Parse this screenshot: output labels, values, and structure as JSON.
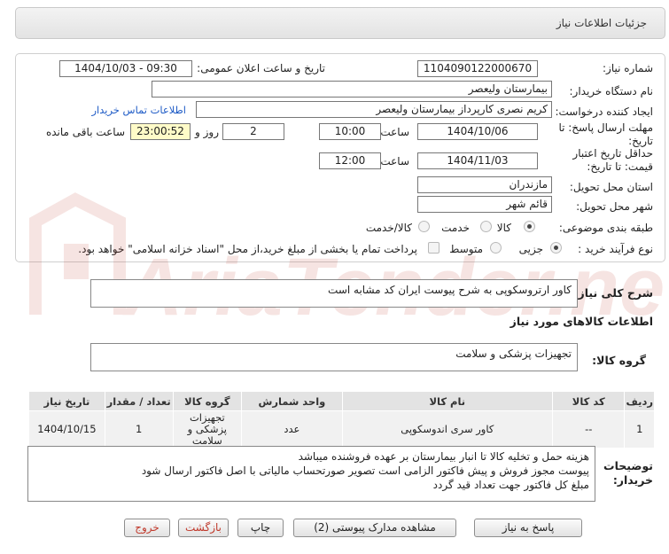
{
  "header": {
    "title": "جزئیات اطلاعات نیاز"
  },
  "form": {
    "need_number_label": "شماره نیاز:",
    "need_number": "1104090122000670",
    "announce_label": "تاریخ و ساعت اعلان عمومی:",
    "announce_value": "1404/10/03 - 09:30",
    "buyer_org_label": "نام دستگاه خریدار:",
    "buyer_org": "بیمارستان ولیعصر",
    "creator_label": "ایجاد کننده درخواست:",
    "creator": "کریم نصری کارپرداز بیمارستان ولیعصر",
    "contact_link": "اطلاعات تماس خریدار",
    "deadline_label": "مهلت ارسال پاسخ: تا تاریخ:",
    "deadline_date": "1404/10/06",
    "time_label": "ساعت",
    "deadline_time": "10:00",
    "days_value": "2",
    "days_label": "روز و",
    "remaining_time": "23:00:52",
    "remaining_label": "ساعت باقی مانده",
    "validity_label": "حداقل تاریخ اعتبار قیمت: تا تاریخ:",
    "validity_date": "1404/11/03",
    "validity_time": "12:00",
    "province_label": "استان محل تحویل:",
    "province": "مازندران",
    "city_label": "شهر محل تحویل:",
    "city": "قائم شهر",
    "category_label": "طبقه بندی موضوعی:",
    "category_options": [
      "کالا",
      "خدمت",
      "کالا/خدمت"
    ],
    "category_selected": "کالا",
    "process_label": "نوع فرآیند خرید :",
    "process_options": [
      "جزیی",
      "متوسط"
    ],
    "process_selected": "جزیی",
    "payment_note": "پرداخت تمام یا بخشی از مبلغ خرید،از محل \"اسناد خزانه اسلامی\" خواهد بود."
  },
  "summary": {
    "label": "شرح کلی نیاز:",
    "value": "کاور ارتروسکوپی به شرح پیوست    ایران کد مشابه است"
  },
  "goods_info_title": "اطلاعات کالاهای مورد نیاز",
  "goods_group": {
    "label": "گروه کالا:",
    "value": "تجهیزات پزشکی و سلامت"
  },
  "table": {
    "headers": [
      "ردیف",
      "کد کالا",
      "نام کالا",
      "واحد شمارش",
      "گروه کالا",
      "تعداد / مقدار",
      "تاریخ نیاز"
    ],
    "rows": [
      [
        "1",
        "--",
        "کاور سری اندوسکوپی",
        "عدد",
        "تجهیزات پزشکی و سلامت",
        "1",
        "1404/10/15"
      ]
    ]
  },
  "buyer_notes": {
    "label": "توضیحات خریدار:",
    "lines": [
      "هزینه حمل و تخلیه کالا تا انبار بیمارستان بر عهده فروشنده میباشد",
      "پیوست مجوز فروش و پیش فاکتور الزامی است  تصویر صورتحساب مالیاتی با اصل فاکتور ارسال شود",
      "مبلغ کل فاکتور جهت تعداد قید گردد"
    ]
  },
  "buttons": {
    "reply": "پاسخ به نیاز",
    "view_docs": "مشاهده مدارک پیوستی (2)",
    "print": "چاپ",
    "back": "بازگشت",
    "exit": "خروج"
  },
  "watermark": "AriaTender.neT",
  "colors": {
    "link": "#1e5bc6",
    "highlight": "#fffbc8",
    "header_bg": "#e3e3e3",
    "danger": "#c0392b"
  }
}
